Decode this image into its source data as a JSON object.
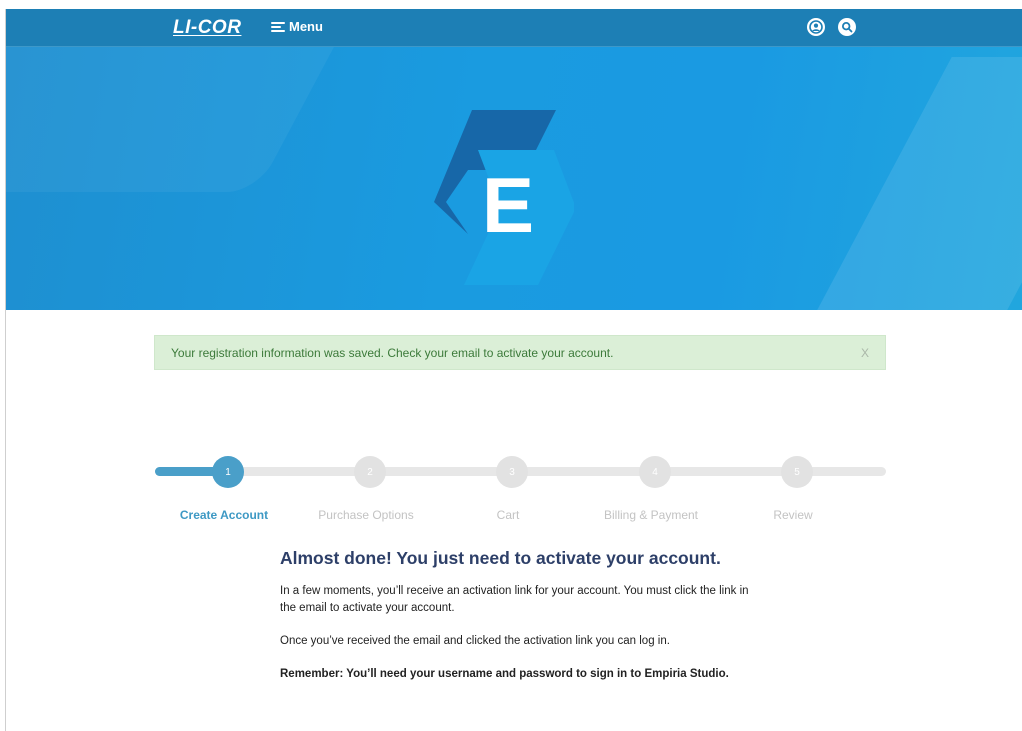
{
  "header": {
    "logo_text": "LI-COR",
    "menu_label": "Menu",
    "icons": [
      "user-icon",
      "search-icon"
    ]
  },
  "hero": {
    "logo_letter": "E"
  },
  "alert": {
    "message": "Your registration information was saved. Check your email to activate your account.",
    "close_label": "X"
  },
  "stepper": {
    "steps": [
      {
        "number": "1",
        "label": "Create Account",
        "active": true
      },
      {
        "number": "2",
        "label": "Purchase Options",
        "active": false
      },
      {
        "number": "3",
        "label": "Cart",
        "active": false
      },
      {
        "number": "4",
        "label": "Billing & Payment",
        "active": false
      },
      {
        "number": "5",
        "label": "Review",
        "active": false
      }
    ]
  },
  "content": {
    "heading": "Almost done! You just need to activate your account.",
    "paragraph1": "In a few moments, you’ll receive an activation link for your account. You must click the link in the email to activate your account.",
    "paragraph2": "Once you’ve received the email and clicked the activation link you can log in.",
    "paragraph3": "Remember: You’ll need your username and password to sign in to Empiria Studio."
  },
  "colors": {
    "nav_bg": "#1d7fb5",
    "hero_bg": "#1a9be0",
    "accent": "#4a9fc9",
    "alert_bg": "#dbefd7",
    "alert_text": "#3c7a3a",
    "heading": "#2d3f68"
  }
}
